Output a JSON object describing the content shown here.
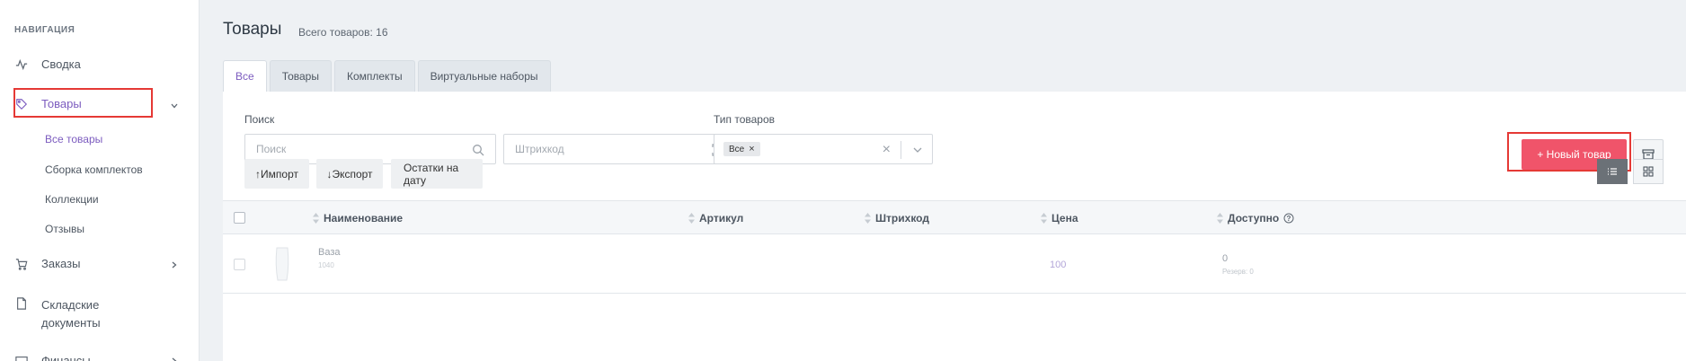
{
  "sidebar": {
    "heading": "НАВИГАЦИЯ",
    "items": [
      {
        "label": "Сводка",
        "icon": "activity-icon"
      },
      {
        "label": "Товары",
        "icon": "tag-icon"
      },
      {
        "label": "Заказы",
        "icon": "cart-icon"
      },
      {
        "label": "Складские",
        "label2": "документы",
        "icon": "document-icon"
      },
      {
        "label": "Финансы",
        "icon": "wallet-icon"
      }
    ],
    "subitems": [
      "Все товары",
      "Сборка комплектов",
      "Коллекции",
      "Отзывы"
    ]
  },
  "header": {
    "title": "Товары",
    "count": "Всего товаров: 16"
  },
  "tabs": [
    "Все",
    "Товары",
    "Комплекты",
    "Виртуальные наборы"
  ],
  "filters": {
    "search_label": "Поиск",
    "search_placeholder": "Поиск",
    "barcode_placeholder": "Штрихкод",
    "type_label": "Тип товаров",
    "type_chip": "Все"
  },
  "actions": {
    "new_product": "+ Новый товар",
    "import": "↑Импорт",
    "export": "↓Экспорт",
    "stock_by_date": "Остатки на дату"
  },
  "table": {
    "columns": [
      "Наименование",
      "Артикул",
      "Штрихкод",
      "Цена",
      "Доступно"
    ],
    "rows": [
      {
        "name": "Ваза",
        "sub": "1040",
        "price": "100",
        "available": "0",
        "reserve": "Резерв: 0"
      }
    ]
  },
  "colors": {
    "accent": "#7c5cbf",
    "primary_button": "#f0546a",
    "highlight": "#e53935"
  }
}
